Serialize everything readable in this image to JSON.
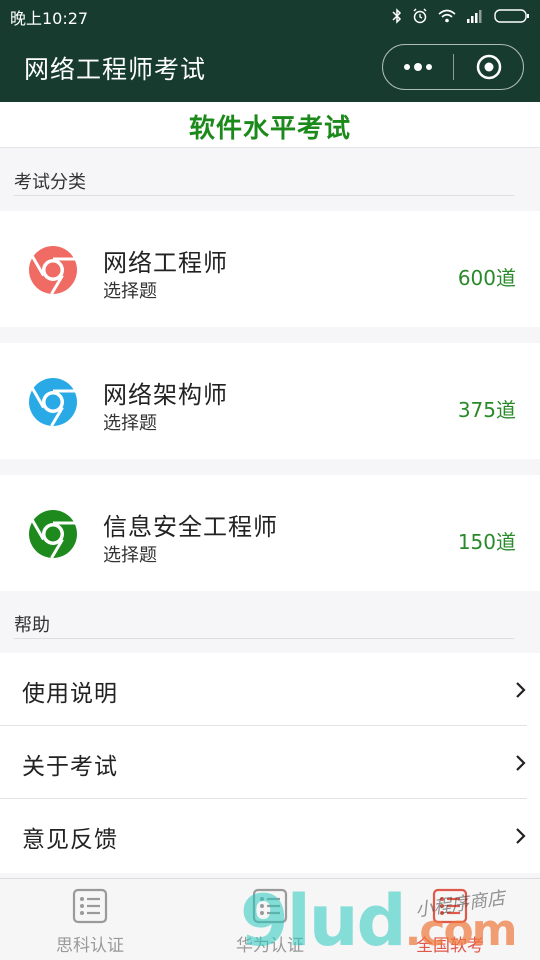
{
  "status": {
    "time": "晚上10:27"
  },
  "nav": {
    "title": "网络工程师考试"
  },
  "banner": {
    "title": "软件水平考试"
  },
  "categories_section": {
    "header": "考试分类",
    "items": [
      {
        "title": "网络工程师",
        "subtitle": "选择题",
        "count": "600道",
        "icon": "chrome-icon",
        "color": "#ef6b64"
      },
      {
        "title": "网络架构师",
        "subtitle": "选择题",
        "count": "375道",
        "icon": "chrome-icon",
        "color": "#29a9e6"
      },
      {
        "title": "信息安全工程师",
        "subtitle": "选择题",
        "count": "150道",
        "icon": "chrome-icon",
        "color": "#1e8a1e"
      }
    ]
  },
  "help_section": {
    "header": "帮助",
    "items": [
      {
        "label": "使用说明"
      },
      {
        "label": "关于考试"
      },
      {
        "label": "意见反馈"
      }
    ]
  },
  "tabbar": {
    "tabs": [
      {
        "label": "思科认证",
        "icon": "list-icon"
      },
      {
        "label": "华为认证",
        "icon": "list-icon"
      },
      {
        "label": "全国软考",
        "icon": "list-icon",
        "active_color": "#e0584a"
      }
    ]
  },
  "watermark": {
    "text": "9lud",
    "suffix": ".com",
    "small": "小程序商店"
  },
  "colors": {
    "nav_bg": "#173c2f",
    "accent_green": "#1b8a1b",
    "count_green": "#2a8a2a"
  }
}
